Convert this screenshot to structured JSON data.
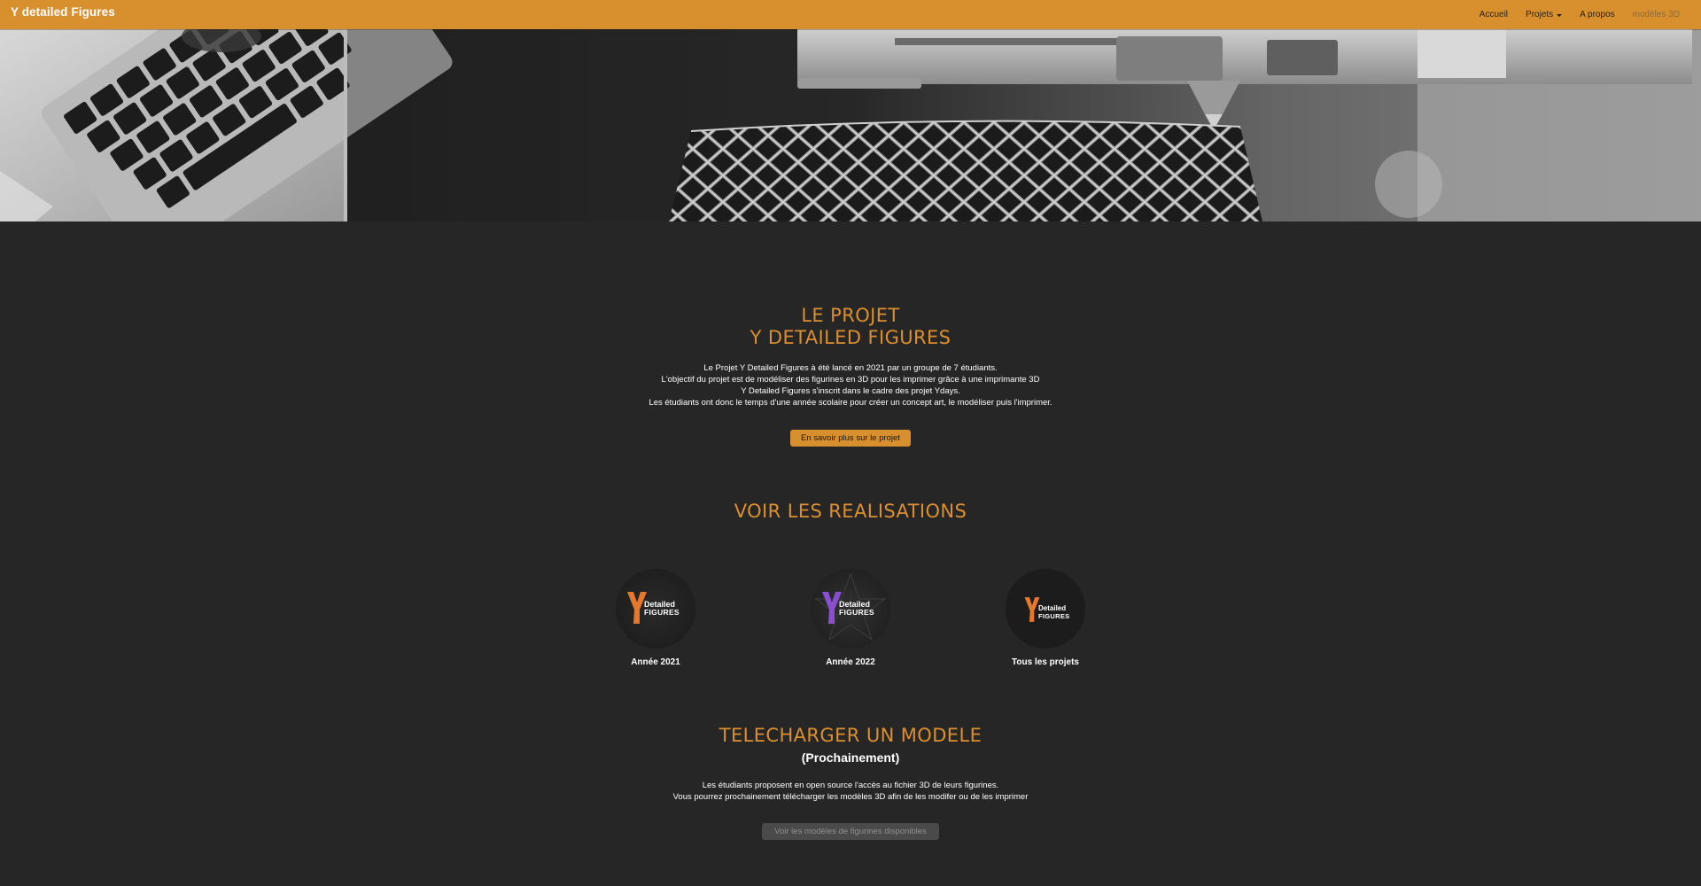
{
  "navbar": {
    "brand": "Y detailed Figures",
    "items": [
      {
        "label": "Accueil"
      },
      {
        "label": "Projets"
      },
      {
        "label": "A propos"
      },
      {
        "label": "modèles 3D"
      }
    ]
  },
  "project": {
    "title_line1": "LE PROJET",
    "title_line2": "Y DETAILED FIGURES",
    "paragraph": [
      "Le Projet Y Detailed Figures à été lancé en 2021 par un groupe de 7 étudiants.",
      "L'objectif du projet est de modéliser des figurines en 3D pour les imprimer grâce à une imprimante 3D",
      "Y Detailed Figures s'inscrit dans le cadre des projet Ydays.",
      "Les étudiants ont donc le temps d'une année scolaire pour créer un concept art, le modéliser puis l'imprimer."
    ],
    "button": "En savoir plus sur le projet"
  },
  "realisations": {
    "title": "VOIR LES REALISATIONS",
    "cards": [
      {
        "label": "Année 2021",
        "logo_top": "Detailed",
        "logo_bottom": "FIGURES",
        "y_color": "#e8772e"
      },
      {
        "label": "Année 2022",
        "logo_top": "Detailed",
        "logo_bottom": "FIGURES",
        "y_color": "#8a4fd0"
      },
      {
        "label": "Tous les projets",
        "logo_top": "Detailed",
        "logo_bottom": "FIGURES",
        "y_color": "#e8772e"
      }
    ]
  },
  "download": {
    "title": "TELECHARGER UN MODELE",
    "subtitle": "(Prochainement)",
    "paragraph": [
      "Les étudiants proposent en open source l'accès au fichier 3D de leurs figurines.",
      "Vous pourrez prochainement télécharger les modèles 3D afin de les modifer ou de les imprimer"
    ],
    "button": "Voir les modèles de figurines disponibles"
  },
  "colors": {
    "accent": "#d8902e",
    "title": "#dc8f2e",
    "background": "#262626"
  }
}
